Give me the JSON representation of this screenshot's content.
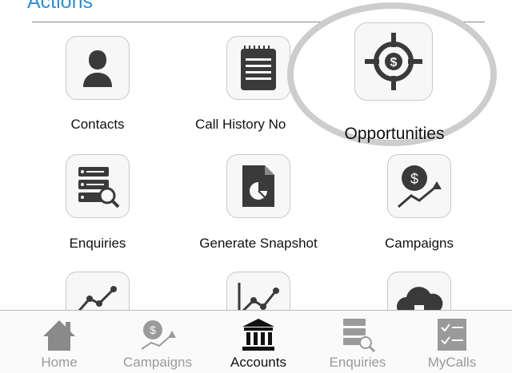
{
  "section": {
    "title": "Actions"
  },
  "actions": [
    {
      "label": "Contacts",
      "icon": "person-icon"
    },
    {
      "label": "Call History No",
      "icon": "notepad-icon"
    },
    {
      "label": "Opportunities",
      "icon": "target-dollar-icon"
    },
    {
      "label": "Enquiries",
      "icon": "list-search-icon"
    },
    {
      "label": "Generate Snapshot",
      "icon": "pie-document-icon"
    },
    {
      "label": "Campaigns",
      "icon": "dollar-trend-icon"
    }
  ],
  "tabbar": {
    "items": [
      {
        "label": "Home",
        "icon": "house-icon",
        "active": false
      },
      {
        "label": "Campaigns",
        "icon": "dollar-trend-icon",
        "active": false
      },
      {
        "label": "Accounts",
        "icon": "bank-icon",
        "active": true
      },
      {
        "label": "Enquiries",
        "icon": "list-search-icon",
        "active": false
      },
      {
        "label": "MyCalls",
        "icon": "checklist-icon",
        "active": false
      }
    ]
  },
  "colors": {
    "accent": "#2f8fd0",
    "icon_dark": "#3a3a3a",
    "tab_inactive": "#9a9a9a"
  }
}
